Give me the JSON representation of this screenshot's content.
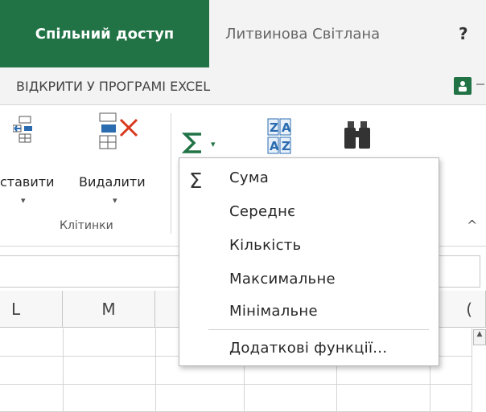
{
  "titlebar": {
    "share_tab": "Спільний доступ",
    "user_name": "Литвинова Світлана",
    "help": "?"
  },
  "openbar": {
    "open_in_excel": "ВІДКРИТИ У ПРОГРАМІ EXCEL"
  },
  "ribbon": {
    "insert_label": "ставити",
    "delete_label": "Видалити",
    "cells_group": "Клітинки",
    "autosum_caret": "▾",
    "sort_icon_top": "Z A",
    "sort_icon_bottom": "A Z"
  },
  "columns": [
    "L",
    "M",
    "("
  ],
  "autosum_menu": {
    "items": [
      "Сума",
      "Середнє",
      "Кількість",
      "Максимальне",
      "Мінімальне"
    ],
    "more": "Додаткові функції..."
  },
  "colors": {
    "excel_green": "#217346",
    "delete_red": "#d9381e",
    "sort_blue": "#2b6cb0"
  }
}
